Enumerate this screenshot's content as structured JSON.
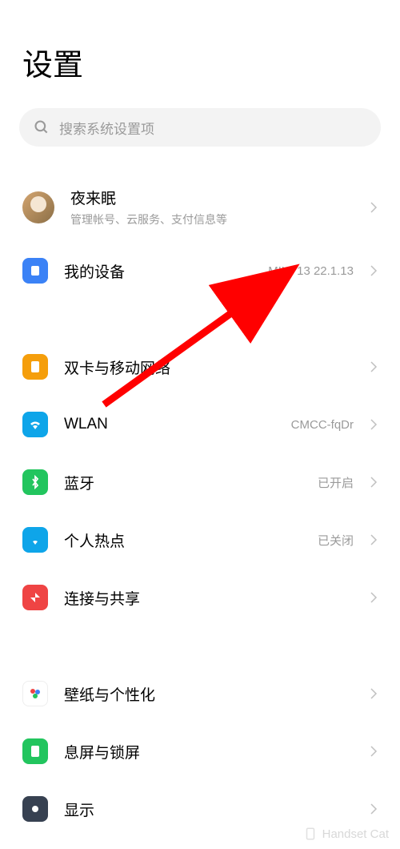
{
  "header": {
    "title": "设置"
  },
  "search": {
    "placeholder": "搜索系统设置项"
  },
  "account": {
    "name": "夜来眠",
    "subtitle": "管理帐号、云服务、支付信息等"
  },
  "items": {
    "my_device": {
      "label": "我的设备",
      "value": "MIUI 13 22.1.13"
    },
    "sim": {
      "label": "双卡与移动网络"
    },
    "wlan": {
      "label": "WLAN",
      "value": "CMCC-fqDr"
    },
    "bluetooth": {
      "label": "蓝牙",
      "value": "已开启"
    },
    "hotspot": {
      "label": "个人热点",
      "value": "已关闭"
    },
    "share": {
      "label": "连接与共享"
    },
    "wallpaper": {
      "label": "壁纸与个性化"
    },
    "lockscreen": {
      "label": "息屏与锁屏"
    },
    "display": {
      "label": "显示"
    }
  },
  "watermark": {
    "text": "Handset Cat"
  }
}
